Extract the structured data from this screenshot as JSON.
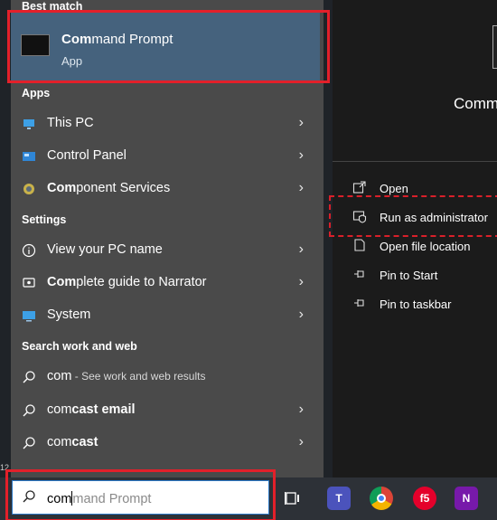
{
  "left_panel": {
    "best_match_heading": "Best match",
    "best_match": {
      "title_bold": "Com",
      "title_rest": "mand Prompt",
      "subtitle": "App"
    },
    "apps_heading": "Apps",
    "apps": [
      {
        "bold": "",
        "label": "This PC",
        "icon": "this-pc-icon"
      },
      {
        "bold": "",
        "label": "Control Panel",
        "icon": "control-panel-icon"
      },
      {
        "bold": "Com",
        "label": "ponent Services",
        "icon": "component-services-icon"
      }
    ],
    "settings_heading": "Settings",
    "settings": [
      {
        "bold": "",
        "label": "View your PC name",
        "icon": "info-icon"
      },
      {
        "bold": "Com",
        "label": "plete guide to Narrator",
        "icon": "narrator-icon"
      },
      {
        "bold": "",
        "label": "System",
        "icon": "system-icon"
      }
    ],
    "web_heading": "Search work and web",
    "web": [
      {
        "term": "com",
        "suffix": " - See work and web results"
      },
      {
        "term": "com",
        "bold_rest": "cast email"
      },
      {
        "term": "com",
        "bold_rest": "cast"
      }
    ]
  },
  "right_panel": {
    "app_name": "Comm",
    "actions": [
      {
        "label": "Open",
        "icon": "open-icon"
      },
      {
        "label": "Run as administrator",
        "icon": "shield-icon"
      },
      {
        "label": "Open file location",
        "icon": "folder-icon"
      },
      {
        "label": "Pin to Start",
        "icon": "pin-icon"
      },
      {
        "label": "Pin to taskbar",
        "icon": "pin-icon"
      }
    ]
  },
  "taskbar": {
    "search_typed": "com",
    "search_suggestion": "mand Prompt",
    "edge_number": "12",
    "apps": [
      "task-view-icon",
      "teams-icon",
      "chrome-icon",
      "f5-icon",
      "onenote-icon"
    ]
  },
  "colors": {
    "highlight": "#e3202a",
    "selection": "#45627d"
  }
}
